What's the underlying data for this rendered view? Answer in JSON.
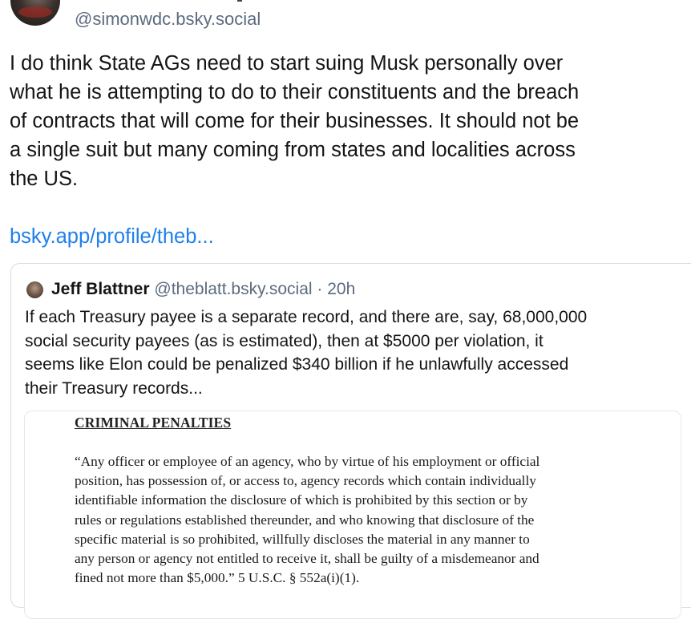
{
  "post": {
    "handle": "@simonwdc.bsky.social",
    "text": "I do think State AGs need to start suing Musk personally over\nwhat he is attempting to do to their constituents and the breach\nof contracts that will come for their businesses.  It should not be\na single suit but many coming from states and localities across\nthe US.",
    "link": "bsky.app/profile/theb..."
  },
  "quote": {
    "author_name": "Jeff Blattner",
    "author_handle": "@theblatt.bsky.social",
    "separator": " · ",
    "time": "20h",
    "text": "If each Treasury payee is a separate record, and there are, say, 68,000,000\nsocial security payees (as is estimated), then at $5000 per violation, it\nseems like Elon could be penalized $340 billion if he unlawfully accessed\ntheir Treasury records..."
  },
  "embed": {
    "heading": "CRIMINAL PENALTIES",
    "body": "“Any officer or employee of an agency, who by virtue of his employment or official\nposition, has possession of, or access to, agency records which contain individually\nidentifiable information the disclosure of which is prohibited by this section or by\nrules or regulations established thereunder, and who knowing that disclosure of the\nspecific material is so prohibited, willfully discloses the material in any manner to\nany person or agency not entitled to receive it, shall be guilty of a misdemeanor and\nfined not more than $5,000.”  5 U.S.C. § 552a(i)(1)."
  },
  "colors": {
    "link": "#1f80e9",
    "secondary_text": "#5b6b7d",
    "border": "#d6dde5"
  }
}
